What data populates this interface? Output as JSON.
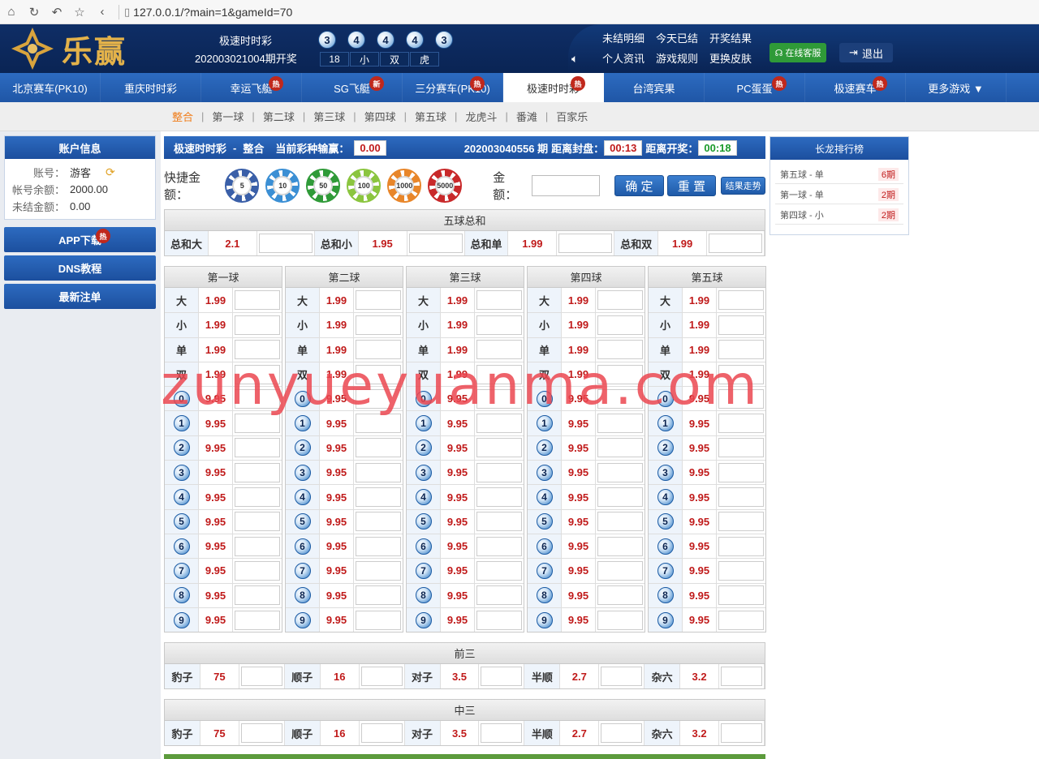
{
  "browser": {
    "url": "127.0.0.1/?main=1&gameId=70"
  },
  "header": {
    "logo_text": "乐赢",
    "lottery_name": "极速时时彩",
    "issue_text": "202003021004期开奖",
    "balls": [
      "3",
      "4",
      "4",
      "4",
      "3"
    ],
    "stats": [
      "18",
      "小",
      "双",
      "虎"
    ],
    "links": [
      "未结明细",
      "今天已结",
      "开奖结果",
      "个人资讯",
      "游戏规则",
      "更换皮肤"
    ],
    "service_label": "在线客服",
    "logout_label": "退出"
  },
  "nav": {
    "items": [
      {
        "label": "北京赛车(PK10)",
        "badge": ""
      },
      {
        "label": "重庆时时彩",
        "badge": ""
      },
      {
        "label": "幸运飞艇",
        "badge": "热"
      },
      {
        "label": "SG飞艇",
        "badge": "新"
      },
      {
        "label": "三分赛车(PK10)",
        "badge": "热"
      },
      {
        "label": "极速时时彩",
        "badge": "热"
      },
      {
        "label": "台湾宾果",
        "badge": ""
      },
      {
        "label": "PC蛋蛋",
        "badge": "热"
      },
      {
        "label": "极速赛车",
        "badge": "热"
      },
      {
        "label": "更多游戏 ▼",
        "badge": ""
      }
    ],
    "active_index": 5
  },
  "subnav": {
    "items": [
      "整合",
      "第一球",
      "第二球",
      "第三球",
      "第四球",
      "第五球",
      "龙虎斗",
      "番滩",
      "百家乐"
    ],
    "active_index": 0
  },
  "account": {
    "title": "账户信息",
    "rows": [
      {
        "k": "账号：",
        "v": "游客"
      },
      {
        "k": "帐号余额：",
        "v": "2000.00"
      },
      {
        "k": "未结金额：",
        "v": "0.00"
      }
    ]
  },
  "side_buttons": [
    {
      "label": "APP下载",
      "badge": "热"
    },
    {
      "label": "DNS教程",
      "badge": ""
    },
    {
      "label": "最新注单",
      "badge": ""
    }
  ],
  "topbar": {
    "game": "极速时时彩",
    "dash": "-",
    "mode": "整合",
    "profit_label": "当前彩种输赢：",
    "profit": "0.00",
    "issue": "202003040556 期",
    "close_label": "距离封盘：",
    "close_time": "00:13",
    "open_label": "距离开奖：",
    "open_time": "00:18"
  },
  "quick": {
    "label": "快捷金额：",
    "chips": [
      {
        "value": "5",
        "color": "#3a5fa8"
      },
      {
        "value": "10",
        "color": "#3b8fd4"
      },
      {
        "value": "50",
        "color": "#2f9a38"
      },
      {
        "value": "100",
        "color": "#8bc53f"
      },
      {
        "value": "1000",
        "color": "#e8862a"
      },
      {
        "value": "5000",
        "color": "#c8292a"
      }
    ],
    "amount_label": "金额：",
    "confirm": "确 定",
    "reset": "重 置",
    "trend": "结果走势"
  },
  "sum_section": {
    "title": "五球总和",
    "items": [
      {
        "k": "总和大",
        "odds": "2.1"
      },
      {
        "k": "总和小",
        "odds": "1.95"
      },
      {
        "k": "总和单",
        "odds": "1.99"
      },
      {
        "k": "总和双",
        "odds": "1.99"
      }
    ]
  },
  "balls_section": {
    "columns": [
      "第一球",
      "第二球",
      "第三球",
      "第四球",
      "第五球"
    ],
    "rows": [
      {
        "k": "大",
        "odds": "1.99",
        "type": "text"
      },
      {
        "k": "小",
        "odds": "1.99",
        "type": "text"
      },
      {
        "k": "单",
        "odds": "1.99",
        "type": "text"
      },
      {
        "k": "双",
        "odds": "1.99",
        "type": "text"
      },
      {
        "k": "0",
        "odds": "9.95",
        "type": "ball"
      },
      {
        "k": "1",
        "odds": "9.95",
        "type": "ball"
      },
      {
        "k": "2",
        "odds": "9.95",
        "type": "ball"
      },
      {
        "k": "3",
        "odds": "9.95",
        "type": "ball"
      },
      {
        "k": "4",
        "odds": "9.95",
        "type": "ball"
      },
      {
        "k": "5",
        "odds": "9.95",
        "type": "ball"
      },
      {
        "k": "6",
        "odds": "9.95",
        "type": "ball"
      },
      {
        "k": "7",
        "odds": "9.95",
        "type": "ball"
      },
      {
        "k": "8",
        "odds": "9.95",
        "type": "ball"
      },
      {
        "k": "9",
        "odds": "9.95",
        "type": "ball"
      }
    ]
  },
  "front_three": {
    "title": "前三",
    "items": [
      {
        "k": "豹子",
        "odds": "75"
      },
      {
        "k": "顺子",
        "odds": "16"
      },
      {
        "k": "对子",
        "odds": "3.5"
      },
      {
        "k": "半顺",
        "odds": "2.7"
      },
      {
        "k": "杂六",
        "odds": "3.2"
      }
    ]
  },
  "middle_three": {
    "title": "中三",
    "items": [
      {
        "k": "豹子",
        "odds": "75"
      },
      {
        "k": "顺子",
        "odds": "16"
      },
      {
        "k": "对子",
        "odds": "3.5"
      },
      {
        "k": "半顺",
        "odds": "2.7"
      },
      {
        "k": "杂六",
        "odds": "3.2"
      }
    ]
  },
  "long_dragon": {
    "title": "长龙排行榜",
    "rows": [
      {
        "name": "第五球 - 单",
        "period": "6期"
      },
      {
        "name": "第一球 - 单",
        "period": "2期"
      },
      {
        "name": "第四球 - 小",
        "period": "2期"
      }
    ]
  },
  "watermark": "zunyueyuanma.com",
  "colors": {
    "header_bg": "#0f2e66",
    "nav_bg": "#2d6bc0",
    "odds_red": "#c01a1a",
    "active_sub": "#f07d1a",
    "service_green": "#2f9a38"
  }
}
